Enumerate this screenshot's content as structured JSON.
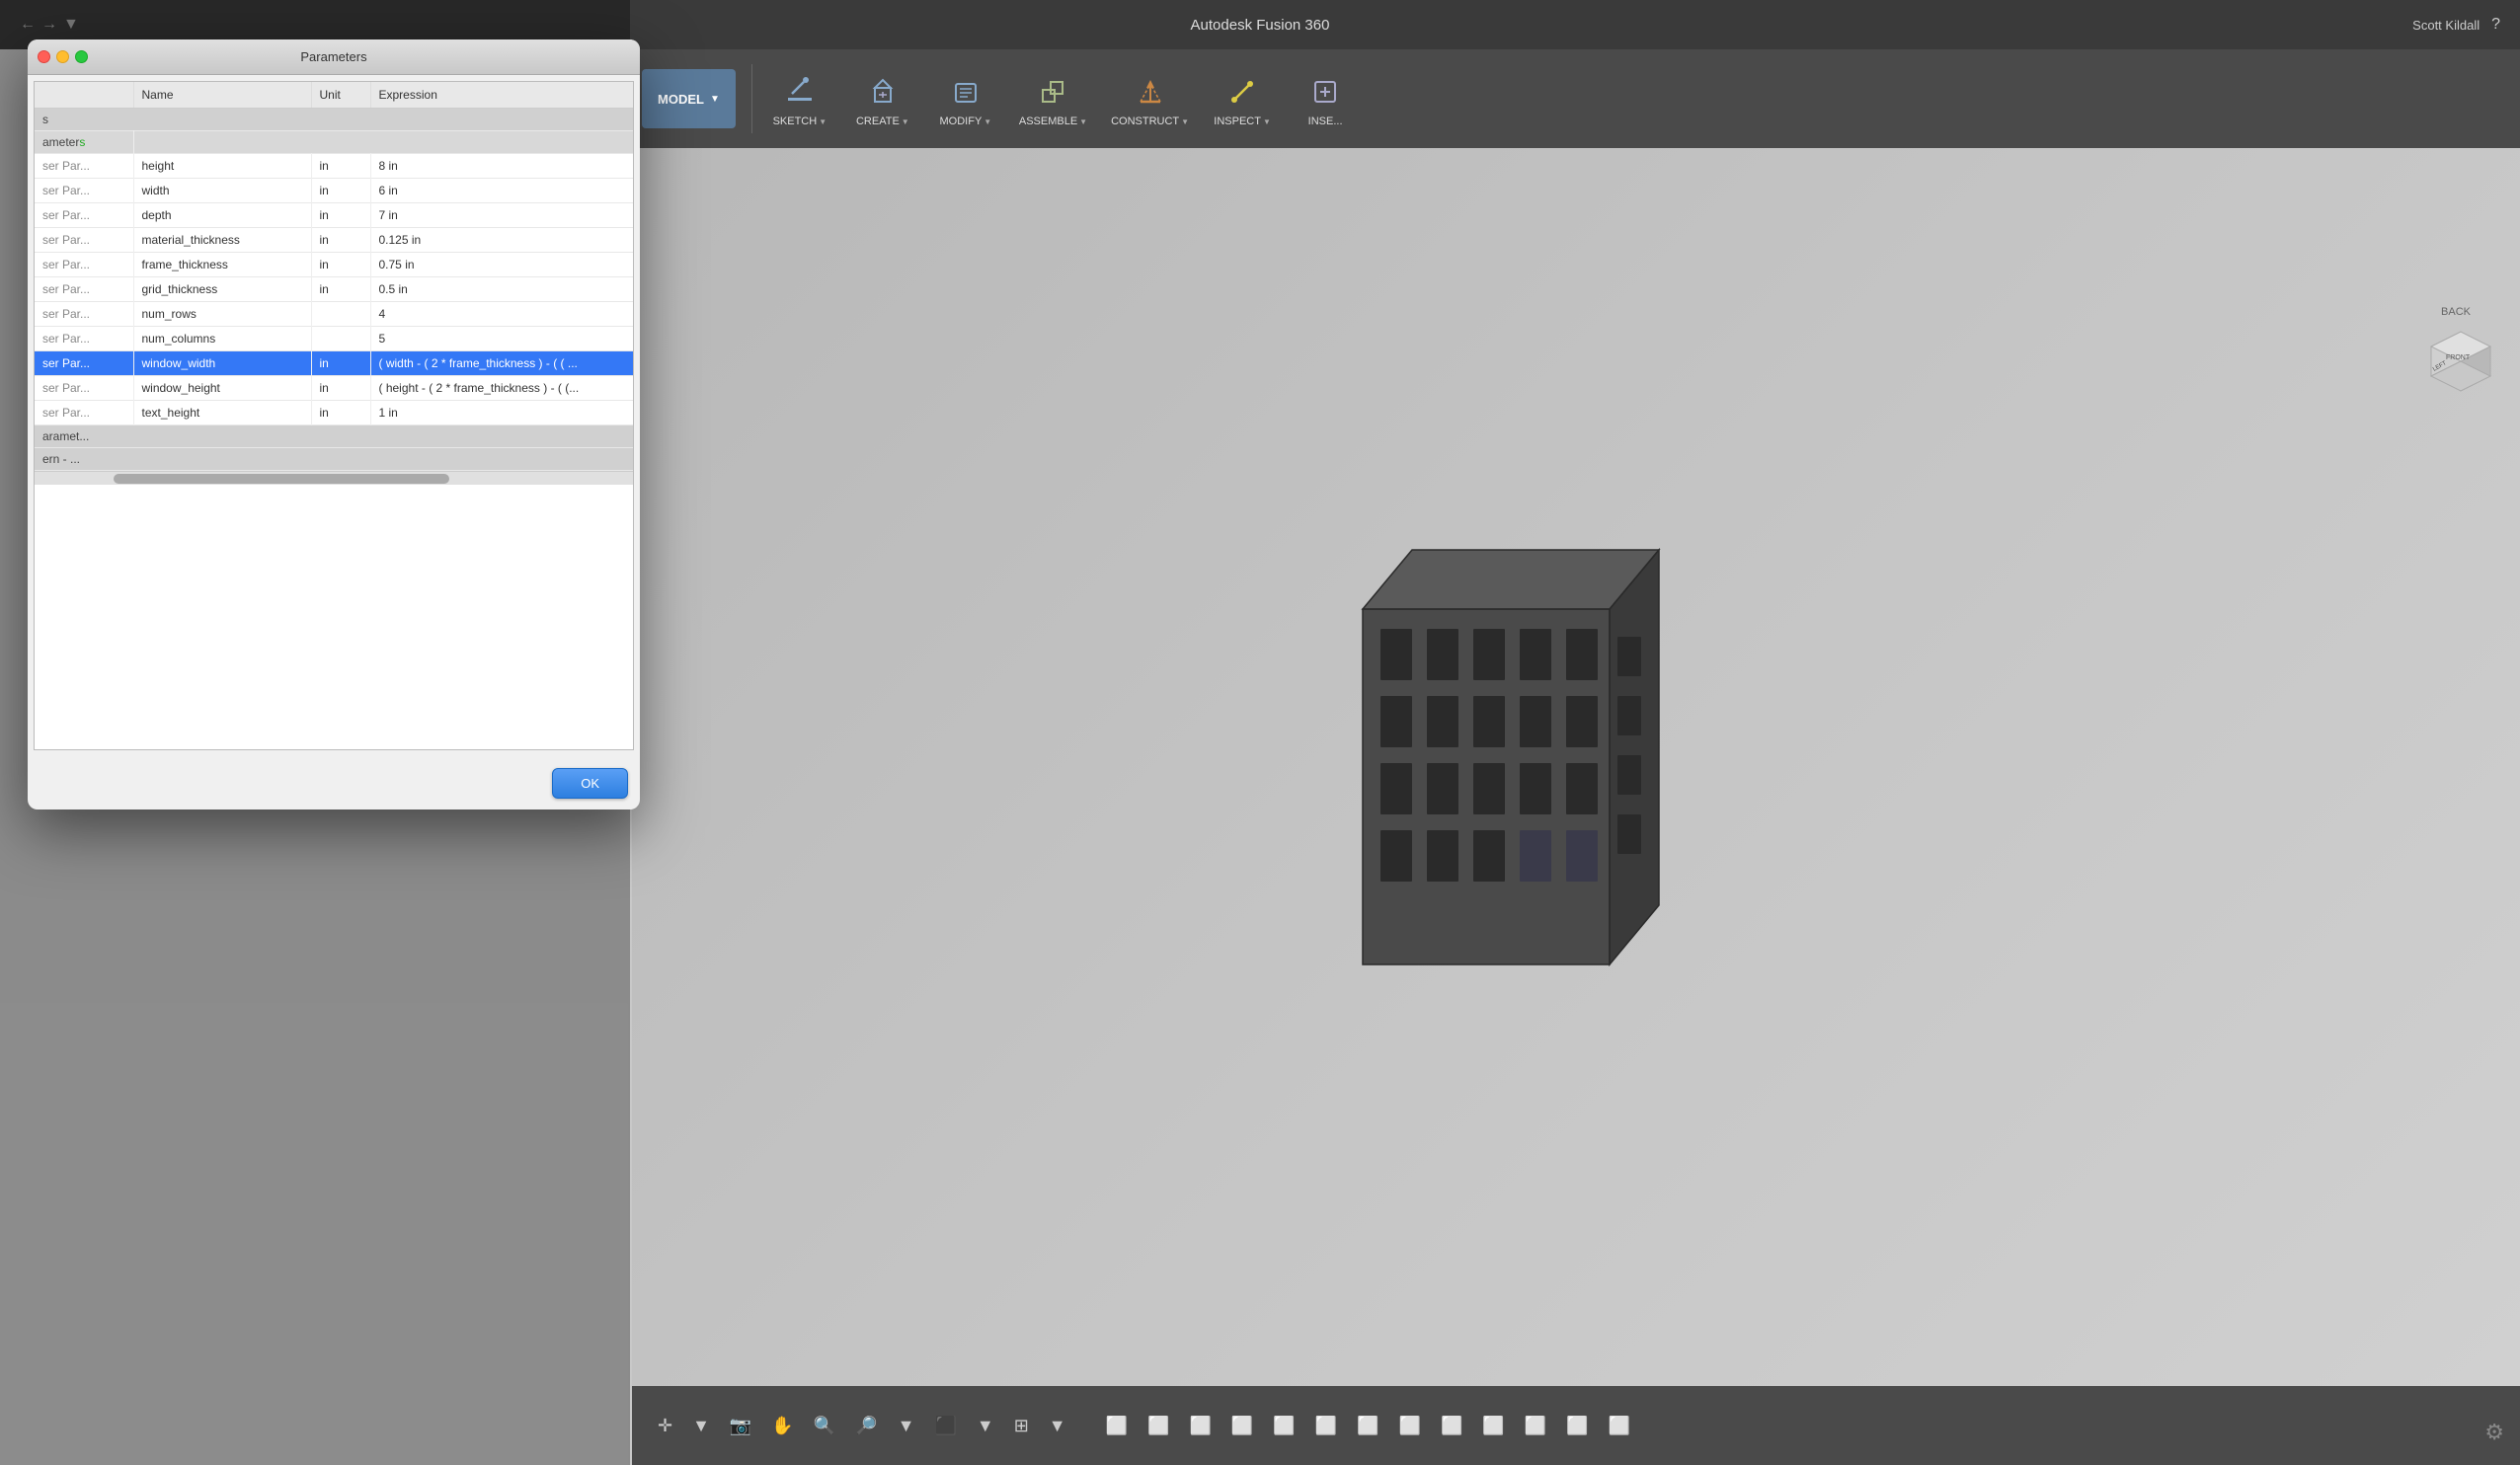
{
  "app": {
    "title": "Autodesk Fusion 360",
    "user": "Scott Kildall"
  },
  "dialog": {
    "title": "Parameters",
    "ok_label": "OK"
  },
  "table": {
    "headers": [
      "",
      "Name",
      "Unit",
      "Expression"
    ],
    "sections": [
      {
        "label": "s",
        "rows": []
      },
      {
        "label": "ameters",
        "rows": []
      },
      {
        "type": "params",
        "rows": [
          {
            "source": "ser Par...",
            "name": "height",
            "unit": "in",
            "expression": "8 in",
            "selected": false
          },
          {
            "source": "ser Par...",
            "name": "width",
            "unit": "in",
            "expression": "6 in",
            "selected": false
          },
          {
            "source": "ser Par...",
            "name": "depth",
            "unit": "in",
            "expression": "7 in",
            "selected": false
          },
          {
            "source": "ser Par...",
            "name": "material_thickness",
            "unit": "in",
            "expression": "0.125 in",
            "selected": false
          },
          {
            "source": "ser Par...",
            "name": "frame_thickness",
            "unit": "in",
            "expression": "0.75 in",
            "selected": false
          },
          {
            "source": "ser Par...",
            "name": "grid_thickness",
            "unit": "in",
            "expression": "0.5 in",
            "selected": false
          },
          {
            "source": "ser Par...",
            "name": "num_rows",
            "unit": "",
            "expression": "4",
            "selected": false
          },
          {
            "source": "ser Par...",
            "name": "num_columns",
            "unit": "",
            "expression": "5",
            "selected": false
          },
          {
            "source": "ser Par...",
            "name": "window_width",
            "unit": "in",
            "expression": "( width - ( 2 * frame_thickness ) - ( ( ...",
            "selected": true
          },
          {
            "source": "ser Par...",
            "name": "window_height",
            "unit": "in",
            "expression": "( height - ( 2 * frame_thickness ) - ( (...",
            "selected": false
          },
          {
            "source": "ser Par...",
            "name": "text_height",
            "unit": "in",
            "expression": "1 in",
            "selected": false
          }
        ]
      },
      {
        "label": "aramet...",
        "rows": []
      },
      {
        "label": "ern - ...",
        "rows": []
      }
    ]
  },
  "toolbar": {
    "model_label": "MODEL",
    "groups": [
      {
        "id": "sketch",
        "label": "SKETCH",
        "has_arrow": true
      },
      {
        "id": "create",
        "label": "CREATE",
        "has_arrow": true
      },
      {
        "id": "modify",
        "label": "MODIFY",
        "has_arrow": true
      },
      {
        "id": "assemble",
        "label": "ASSEMBLE",
        "has_arrow": true
      },
      {
        "id": "construct",
        "label": "CONSTRUCT",
        "has_arrow": true
      },
      {
        "id": "inspect",
        "label": "INSPECT",
        "has_arrow": true
      },
      {
        "id": "insert",
        "label": "INSE...",
        "has_arrow": false
      }
    ]
  },
  "nav_cube": {
    "back_label": "BACK"
  },
  "colors": {
    "selected_row_bg": "#3478f6",
    "toolbar_bg": "#4a4a4a",
    "viewport_bg": "#c5c5c5"
  }
}
